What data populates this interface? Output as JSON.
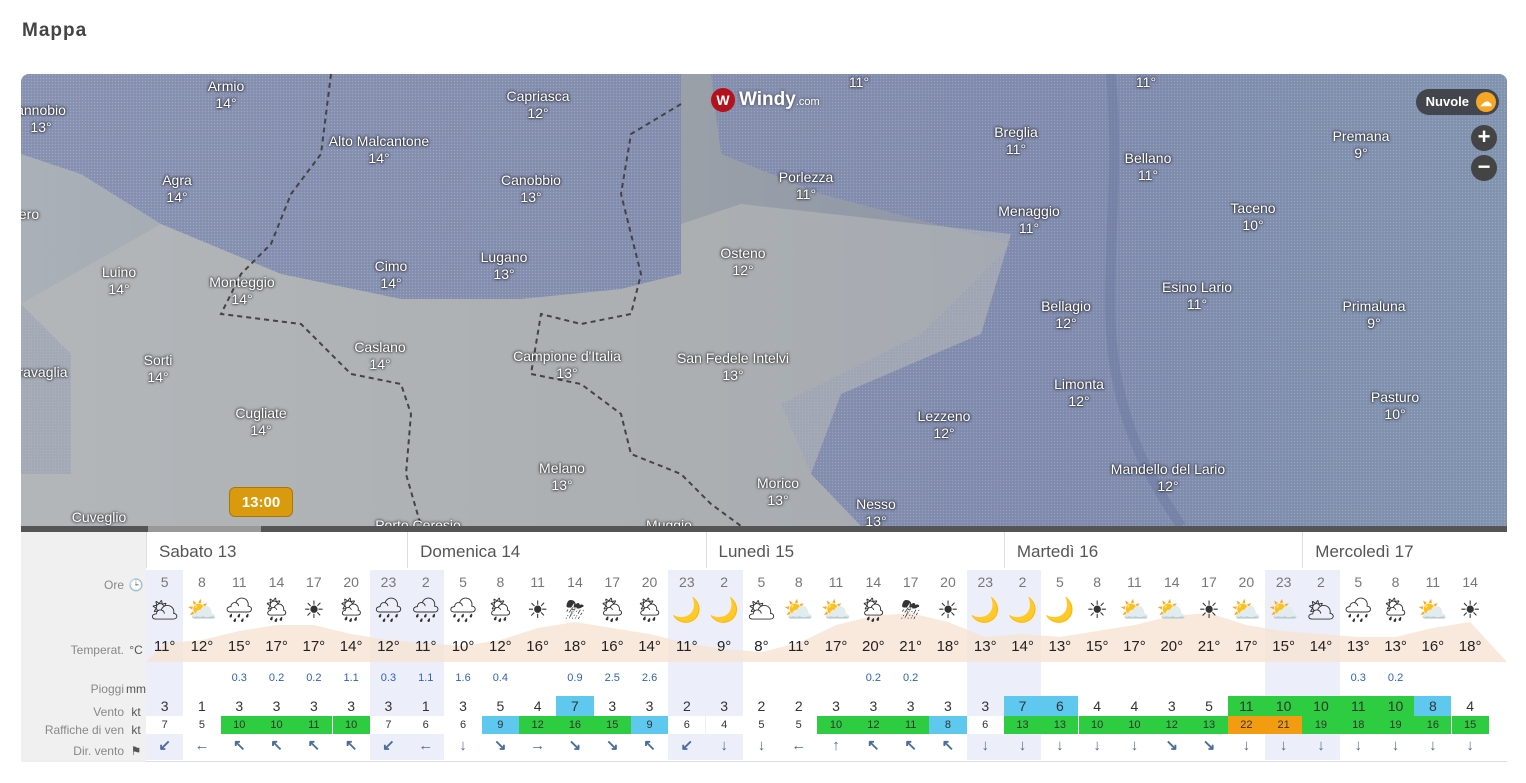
{
  "page_title": "Mappa",
  "map": {
    "logo": {
      "mark": "W",
      "name": "Windy",
      "suffix": ".com"
    },
    "layer_button": "Nuvole",
    "layer_icon": "cloud-sun-icon",
    "zoom_in": "+",
    "zoom_out": "−",
    "time_badge": "13:00",
    "places": [
      {
        "name": "Armio",
        "temp": "14°"
      },
      {
        "name": "annobio",
        "temp": "13°"
      },
      {
        "name": "Capriasca",
        "temp": "12°"
      },
      {
        "name": "Alto Malcantone",
        "temp": "14°"
      },
      {
        "name": "Agra",
        "temp": "14°"
      },
      {
        "name": "Canobbio",
        "temp": "13°"
      },
      {
        "name": "ero",
        "temp": ""
      },
      {
        "name": "Luino",
        "temp": "14°"
      },
      {
        "name": "Monteggio",
        "temp": "14°"
      },
      {
        "name": "Cimo",
        "temp": "14°"
      },
      {
        "name": "Lugano",
        "temp": "13°"
      },
      {
        "name": "Osteno",
        "temp": "12°"
      },
      {
        "name": "Porlezza",
        "temp": "11°"
      },
      {
        "name": "Sorti",
        "temp": "14°"
      },
      {
        "name": "ravaglia",
        "temp": ""
      },
      {
        "name": "Caslano",
        "temp": "14°"
      },
      {
        "name": "Campione d'Italia",
        "temp": "13°"
      },
      {
        "name": "San Fedele Intelvi",
        "temp": "13°"
      },
      {
        "name": "Cugliate",
        "temp": "14°"
      },
      {
        "name": "Melano",
        "temp": "13°"
      },
      {
        "name": "Morico",
        "temp": "13°"
      },
      {
        "name": "Cuveglio",
        "temp": ""
      },
      {
        "name": "Porto Ceresio",
        "temp": ""
      },
      {
        "name": "Muggio",
        "temp": ""
      },
      {
        "name": "Nesso",
        "temp": "13°"
      },
      {
        "name": "Breglia",
        "temp": "11°"
      },
      {
        "name": "Menaggio",
        "temp": "11°"
      },
      {
        "name": "Bellano",
        "temp": "11°"
      },
      {
        "name": "Bellagio",
        "temp": "12°"
      },
      {
        "name": "Esino Lario",
        "temp": "11°"
      },
      {
        "name": "Limonta",
        "temp": "12°"
      },
      {
        "name": "Lezzeno",
        "temp": "12°"
      },
      {
        "name": "Mandello del Lario",
        "temp": "12°"
      },
      {
        "name": "Premana",
        "temp": "9°"
      },
      {
        "name": "Taceno",
        "temp": "10°"
      },
      {
        "name": "Primaluna",
        "temp": "9°"
      },
      {
        "name": "Pasturo",
        "temp": "10°"
      },
      {
        "name": "",
        "temp": "11°"
      },
      {
        "name": "",
        "temp": "11°"
      }
    ]
  },
  "forecast": {
    "row_labels": [
      {
        "name": "Ore",
        "unit": "🕒"
      },
      {
        "name": "Temperat.",
        "unit": "°C"
      },
      {
        "name": "Pioggi",
        "unit": "mm"
      },
      {
        "name": "Vento",
        "unit": "kt"
      },
      {
        "name": "Raffiche di ven",
        "unit": "kt"
      },
      {
        "name": "Dir. vento",
        "unit": "⚑"
      }
    ],
    "days": [
      {
        "label": "Sabato 13"
      },
      {
        "label": "Domenica 14"
      },
      {
        "label": "Lunedì 15"
      },
      {
        "label": "Martedì 16"
      },
      {
        "label": "Mercoledì 17"
      }
    ],
    "hours": [
      "5",
      "8",
      "11",
      "14",
      "17",
      "20",
      "23",
      "2",
      "5",
      "8",
      "11",
      "14",
      "17",
      "20",
      "23",
      "2",
      "5",
      "8",
      "11",
      "14",
      "17",
      "20",
      "23",
      "2",
      "5",
      "8",
      "11",
      "14",
      "17",
      "20",
      "23",
      "2",
      "5",
      "8",
      "11",
      "14"
    ],
    "icons": [
      "moon-cloud",
      "sun-cloud",
      "cloud-rain",
      "sun-rain",
      "sun",
      "sun-rain",
      "cloud-rain",
      "cloud-rain",
      "moon-rain",
      "sun-rain",
      "sun",
      "sun-storm",
      "sun-rain",
      "sun-rain",
      "moon",
      "moon",
      "moon-cloud",
      "sun-cloud",
      "sun-cloud",
      "sun-rain",
      "sun-storm",
      "sun",
      "moon",
      "moon",
      "moon",
      "sun",
      "sun-cloud",
      "sun-cloud",
      "sun",
      "sun-cloud",
      "sun-cloud",
      "moon-cloud",
      "moon-rain",
      "sun-rain",
      "sun-cloud",
      "sun"
    ],
    "temps": [
      "11°",
      "12°",
      "15°",
      "17°",
      "17°",
      "14°",
      "12°",
      "11°",
      "10°",
      "12°",
      "16°",
      "18°",
      "16°",
      "14°",
      "11°",
      "9°",
      "8°",
      "11°",
      "17°",
      "20°",
      "21°",
      "18°",
      "13°",
      "14°",
      "13°",
      "15°",
      "17°",
      "20°",
      "21°",
      "17°",
      "15°",
      "14°",
      "13°",
      "13°",
      "16°",
      "18°"
    ],
    "rain": [
      "",
      "",
      "0.3",
      "0.2",
      "0.2",
      "1.1",
      "0.3",
      "1.1",
      "1.6",
      "0.4",
      "",
      "0.9",
      "2.5",
      "2.6",
      "",
      "",
      "",
      "",
      "",
      "0.2",
      "0.2",
      "",
      "",
      "",
      "",
      "",
      "",
      "",
      "",
      "",
      "",
      "",
      "0.3",
      "0.2",
      "",
      ""
    ],
    "wind": [
      "3",
      "1",
      "3",
      "3",
      "3",
      "3",
      "3",
      "1",
      "3",
      "5",
      "4",
      "7",
      "3",
      "3",
      "2",
      "3",
      "2",
      "2",
      "3",
      "3",
      "3",
      "3",
      "3",
      "7",
      "6",
      "4",
      "4",
      "3",
      "5",
      "11",
      "10",
      "10",
      "11",
      "10",
      "8",
      "4"
    ],
    "gusts": [
      "7",
      "5",
      "10",
      "10",
      "11",
      "10",
      "7",
      "6",
      "6",
      "9",
      "12",
      "16",
      "15",
      "9",
      "6",
      "4",
      "5",
      "5",
      "10",
      "12",
      "11",
      "8",
      "6",
      "13",
      "13",
      "10",
      "10",
      "12",
      "13",
      "22",
      "21",
      "19",
      "18",
      "19",
      "16",
      "15"
    ],
    "dirs": [
      "↙",
      "←",
      "↖",
      "↖",
      "↖",
      "↖",
      "↙",
      "←",
      "↓",
      "↘",
      "→",
      "↘",
      "↘",
      "↖",
      "↙",
      "↓",
      "↓",
      "←",
      "↑",
      "↖",
      "↖",
      "↖",
      "↓",
      "↓",
      "↓",
      "↓",
      "↓",
      "↘",
      "↘",
      "↓",
      "↓",
      "↓",
      "↓",
      "↓",
      "↓",
      "↓"
    ]
  },
  "colors": {
    "gust_calm": "#ffffff",
    "gust_light": "#5ec8ef",
    "gust_moderate": "#2ecc40",
    "gust_strong": "#f39c12"
  }
}
